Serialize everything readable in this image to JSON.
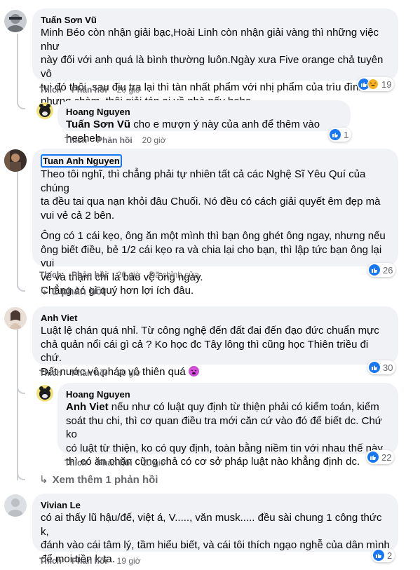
{
  "comments": [
    {
      "name": "Tuấn Sơn Vũ",
      "lines": [
        "Minh Béo còn nhận giải bạc,Hoài Linh còn nhận giải vàng thì những việc như",
        "này đối với anh quá là bình thường luôn.Ngày xưa Five orange chả tuyên vô",
        "tụi đó thôi ,sau điu tra lại thì tàn nhất phẩm với nhị phẩm của trìu đình",
        "nhưng chàm ,thôi giải tán,ai về nhà nấy hehe"
      ],
      "like": "Thích",
      "reply": "Phản hồi",
      "time": "20 giờ",
      "reaction_count": "19"
    },
    {
      "name": "Hoang Nguyen",
      "mention": "Tuấn Sơn Vũ",
      "text": " cho e mượn ý này của anh để thêm vào heeheh",
      "like": "Thích",
      "reply": "Phản hồi",
      "time": "20 giờ",
      "reaction_count": "1"
    },
    {
      "name": "Tuan Anh Nguyen",
      "para1": [
        "Theo tôi nghĩ, thì chẳng phải tự nhiên tất cả các Nghệ Sĩ Yêu Quí của chúng",
        "ta đều tai qua nạn khỏi đâu Chuối. Nó đều có cách giải quyết êm đẹp mà",
        "vui vẻ cả 2 bên."
      ],
      "para2": [
        "Ông có 1 cái kẹo, ông ăn một mình thì bạn ông ghét ông ngay, nhưng nếu",
        "ông biết điều, bẻ 1/2 cái kẹo ra và chia lại cho bạn, thì lập tức bạn ông lại vui",
        "vẻ và thậm chí là bảo vệ ông ngay.",
        "Chẳng có gì quý hơn lợi ích đâu."
      ],
      "like": "Thích",
      "reply": "Phản hồi",
      "time": "20 giờ",
      "edited": "Đã chỉnh sửa",
      "reaction_count": "26",
      "replies_link": "1 phản hồi"
    },
    {
      "name": "Anh Viet",
      "lines": [
        "Luật lệ chán quá nhỉ. Từ công nghệ đến đất đai đến đạo đức chuẩn mực",
        "chả quản nổi cái gì cả ? Ko học đc Tây lông thì cũng học Thiên triều đi chứ.",
        "Đất nước vô pháp vô thiên quá"
      ],
      "like": "Thích",
      "reply": "Phản hồi",
      "time": "20 giờ",
      "reaction_count": "30"
    },
    {
      "name": "Hoang Nguyen",
      "mention": "Anh Viet",
      "first_line": " nếu như có luật quy định từ thiện phải có kiểm toán, kiểm",
      "lines": [
        "soát thu chi, thì cơ quan điều tra mới căn cứ vào đó để biết dc. Chứ ko",
        "có luật từ thiện, ko có quy định, toàn bằng niềm tin với nhau thế này",
        "thì có ăn chặn cũng chả có cơ sở pháp luật nào khẳng định dc."
      ],
      "like": "Thích",
      "reply": "Phản hồi",
      "time": "20 giờ",
      "reaction_count": "22",
      "more_link": "Xem thêm 1 phản hồi"
    },
    {
      "name": "Vivian Le",
      "lines": [
        "có ai thấy lũ hậu/đế, việt á, V....., văn musk..... đều sài chung 1 công thức k,",
        "đánh vào cái tâm lý, tầm hiểu biết, và cái tôi thích ngạo nghễ của dân mình",
        "để moi tiền k ta."
      ],
      "like": "Thích",
      "reply": "Phản hồi",
      "time": "19 giờ",
      "reaction_count": "2"
    }
  ],
  "icons": {
    "like": "like-icon",
    "haha": "haha-icon",
    "reply_arrow": "reply-arrow-icon",
    "emoji": "weary-emoji-icon"
  },
  "colors": {
    "bubble": "#f0f2f5",
    "meta": "#65676b",
    "like_blue": "#1877f2",
    "haha_yellow": "#f7b125"
  }
}
